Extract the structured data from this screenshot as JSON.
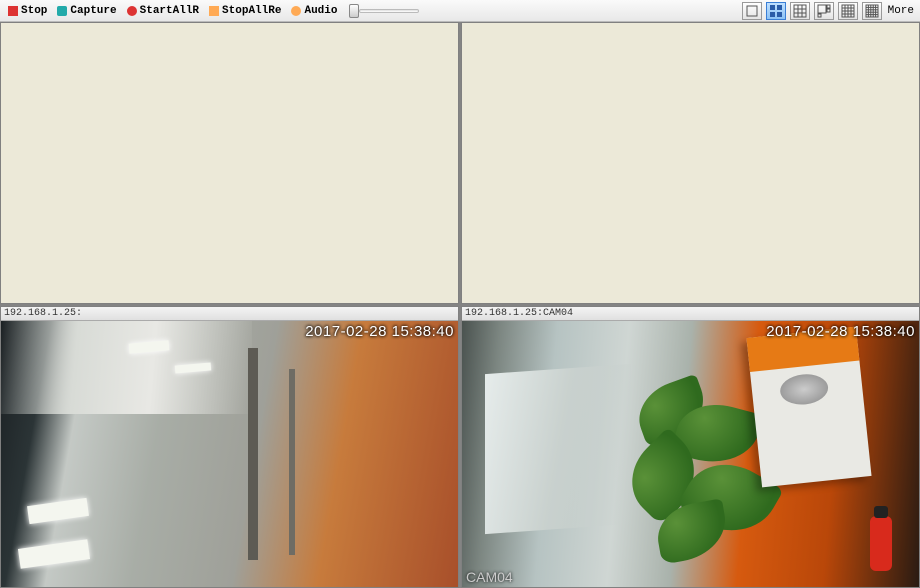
{
  "toolbar": {
    "stop": "Stop",
    "capture": "Capture",
    "startAll": "StartAllR",
    "stopAll": "StopAllRe",
    "audio": "Audio"
  },
  "more_label": "More",
  "layout_active_index": 1,
  "cells": {
    "c0": {
      "title": ""
    },
    "c1": {
      "title": ""
    },
    "c2": {
      "title": "192.168.1.25:",
      "timestamp": "2017-02-28 15:38:40",
      "cam_label": ""
    },
    "c3": {
      "title": "192.168.1.25:CAM04",
      "timestamp": "2017-02-28 15:38:40",
      "cam_label": "CAM04"
    }
  }
}
